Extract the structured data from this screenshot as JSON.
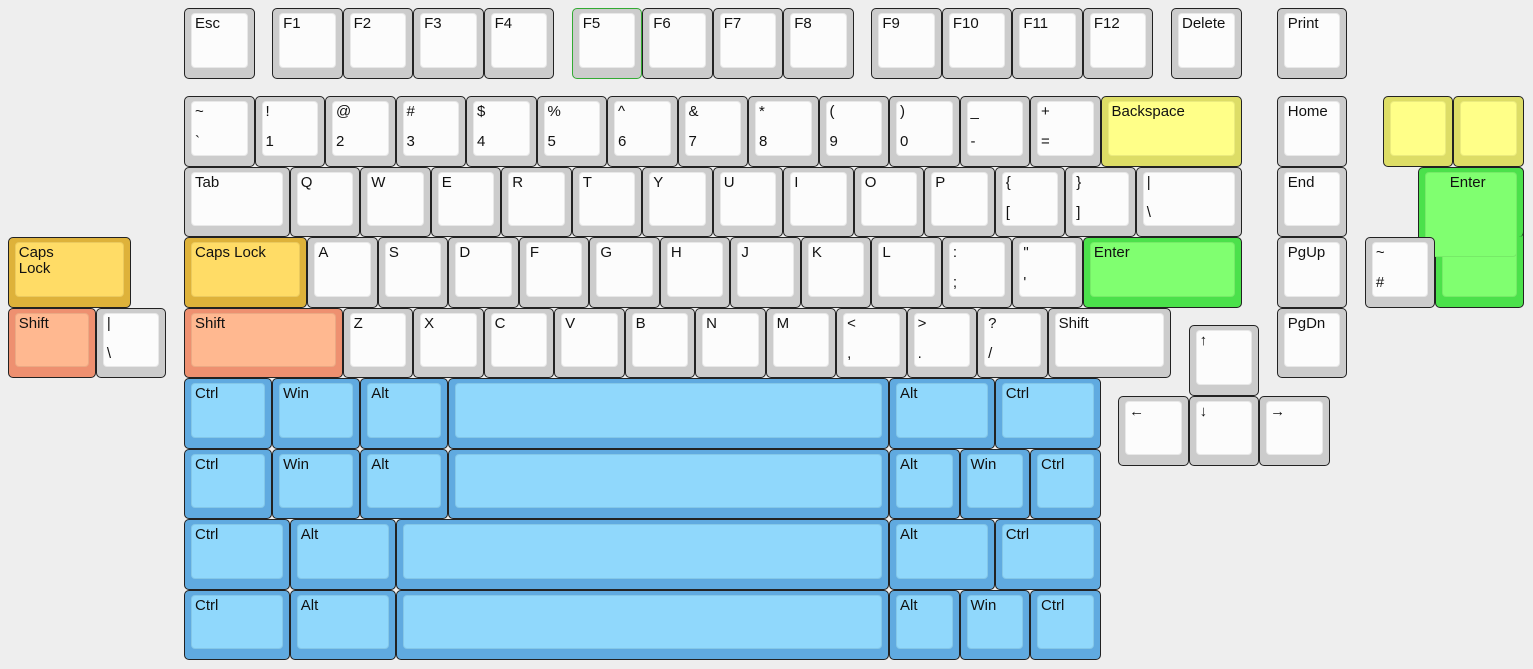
{
  "colors": {
    "gray": "#cccccc",
    "yellow": "#ffff88",
    "green": "#80ff70",
    "caps": "#ffdc66",
    "shift": "#ffb890",
    "blue": "#90d8fc"
  },
  "keys": [
    {
      "top": "Esc",
      "color": "gray"
    },
    {
      "top": "F1",
      "color": "gray"
    },
    {
      "top": "F2",
      "color": "gray"
    },
    {
      "top": "F3",
      "color": "gray"
    },
    {
      "top": "F4",
      "color": "gray"
    },
    {
      "top": "F5",
      "color": "gray",
      "selected": true
    },
    {
      "top": "F6",
      "color": "gray"
    },
    {
      "top": "F7",
      "color": "gray"
    },
    {
      "top": "F8",
      "color": "gray"
    },
    {
      "top": "F9",
      "color": "gray"
    },
    {
      "top": "F10",
      "color": "gray"
    },
    {
      "top": "F11",
      "color": "gray"
    },
    {
      "top": "F12",
      "color": "gray"
    },
    {
      "top": "Delete",
      "color": "gray"
    },
    {
      "top": "Print",
      "color": "gray"
    },
    {
      "top": "~",
      "bottom": "`",
      "color": "gray"
    },
    {
      "top": "!",
      "bottom": "1",
      "color": "gray"
    },
    {
      "top": "@",
      "bottom": "2",
      "color": "gray"
    },
    {
      "top": "#",
      "bottom": "3",
      "color": "gray"
    },
    {
      "top": "$",
      "bottom": "4",
      "color": "gray"
    },
    {
      "top": "%",
      "bottom": "5",
      "color": "gray"
    },
    {
      "top": "^",
      "bottom": "6",
      "color": "gray"
    },
    {
      "top": "&",
      "bottom": "7",
      "color": "gray"
    },
    {
      "top": "*",
      "bottom": "8",
      "color": "gray"
    },
    {
      "top": "(",
      "bottom": "9",
      "color": "gray"
    },
    {
      "top": ")",
      "bottom": "0",
      "color": "gray"
    },
    {
      "top": "_",
      "bottom": "-",
      "color": "gray"
    },
    {
      "top": "+",
      "bottom": "=",
      "color": "gray"
    },
    {
      "top": "Backspace",
      "color": "yellow"
    },
    {
      "top": "Home",
      "color": "gray"
    },
    {
      "top": "",
      "color": "yellow"
    },
    {
      "top": "",
      "color": "yellow"
    },
    {
      "top": "Tab",
      "color": "gray"
    },
    {
      "top": "Q",
      "color": "gray"
    },
    {
      "top": "W",
      "color": "gray"
    },
    {
      "top": "E",
      "color": "gray"
    },
    {
      "top": "R",
      "color": "gray"
    },
    {
      "top": "T",
      "color": "gray"
    },
    {
      "top": "Y",
      "color": "gray"
    },
    {
      "top": "U",
      "color": "gray"
    },
    {
      "top": "I",
      "color": "gray"
    },
    {
      "top": "O",
      "color": "gray"
    },
    {
      "top": "P",
      "color": "gray"
    },
    {
      "top": "{",
      "bottom": "[",
      "color": "gray"
    },
    {
      "top": "}",
      "bottom": "]",
      "color": "gray"
    },
    {
      "top": "|",
      "bottom": "\\",
      "color": "gray"
    },
    {
      "top": "End",
      "color": "gray"
    },
    {
      "top": "Enter",
      "color": "green"
    },
    {
      "top": "Caps Lock",
      "color": "caps"
    },
    {
      "top": "A",
      "color": "gray"
    },
    {
      "top": "S",
      "color": "gray"
    },
    {
      "top": "D",
      "color": "gray"
    },
    {
      "top": "F",
      "color": "gray"
    },
    {
      "top": "G",
      "color": "gray"
    },
    {
      "top": "H",
      "color": "gray"
    },
    {
      "top": "J",
      "color": "gray"
    },
    {
      "top": "K",
      "color": "gray"
    },
    {
      "top": "L",
      "color": "gray"
    },
    {
      "top": ":",
      "bottom": ";",
      "color": "gray"
    },
    {
      "top": "\"",
      "bottom": "'",
      "color": "gray"
    },
    {
      "top": "Enter",
      "color": "green"
    },
    {
      "top": "PgUp",
      "color": "gray"
    },
    {
      "top": "~",
      "bottom": "#",
      "color": "gray"
    },
    {
      "top": "Caps\nLock",
      "color": "caps"
    },
    {
      "top": "Shift",
      "color": "shift"
    },
    {
      "top": "|",
      "bottom": "\\",
      "color": "gray"
    },
    {
      "top": "Shift",
      "color": "shift"
    },
    {
      "top": "Z",
      "color": "gray"
    },
    {
      "top": "X",
      "color": "gray"
    },
    {
      "top": "C",
      "color": "gray"
    },
    {
      "top": "V",
      "color": "gray"
    },
    {
      "top": "B",
      "color": "gray"
    },
    {
      "top": "N",
      "color": "gray"
    },
    {
      "top": "M",
      "color": "gray"
    },
    {
      "top": "<",
      "bottom": ",",
      "color": "gray"
    },
    {
      "top": ">",
      "bottom": ".",
      "color": "gray"
    },
    {
      "top": "?",
      "bottom": "/",
      "color": "gray"
    },
    {
      "top": "Shift",
      "color": "gray"
    },
    {
      "top": "PgDn",
      "color": "gray"
    },
    {
      "top": "↑",
      "color": "gray"
    },
    {
      "top": "Ctrl",
      "color": "blue"
    },
    {
      "top": "Win",
      "color": "blue"
    },
    {
      "top": "Alt",
      "color": "blue"
    },
    {
      "top": "",
      "color": "blue"
    },
    {
      "top": "Alt",
      "color": "blue"
    },
    {
      "top": "Ctrl",
      "color": "blue"
    },
    {
      "top": "←",
      "color": "gray"
    },
    {
      "top": "↓",
      "color": "gray"
    },
    {
      "top": "→",
      "color": "gray"
    },
    {
      "top": "Ctrl",
      "color": "blue"
    },
    {
      "top": "Win",
      "color": "blue"
    },
    {
      "top": "Alt",
      "color": "blue"
    },
    {
      "top": "",
      "color": "blue"
    },
    {
      "top": "Alt",
      "color": "blue"
    },
    {
      "top": "Win",
      "color": "blue"
    },
    {
      "top": "Ctrl",
      "color": "blue"
    },
    {
      "top": "Ctrl",
      "color": "blue"
    },
    {
      "top": "Alt",
      "color": "blue"
    },
    {
      "top": "",
      "color": "blue"
    },
    {
      "top": "Alt",
      "color": "blue"
    },
    {
      "top": "Ctrl",
      "color": "blue"
    },
    {
      "top": "Ctrl",
      "color": "blue"
    },
    {
      "top": "Alt",
      "color": "blue"
    },
    {
      "top": "",
      "color": "blue"
    },
    {
      "top": "Alt",
      "color": "blue"
    },
    {
      "top": "Win",
      "color": "blue"
    },
    {
      "top": "Ctrl",
      "color": "blue"
    }
  ]
}
